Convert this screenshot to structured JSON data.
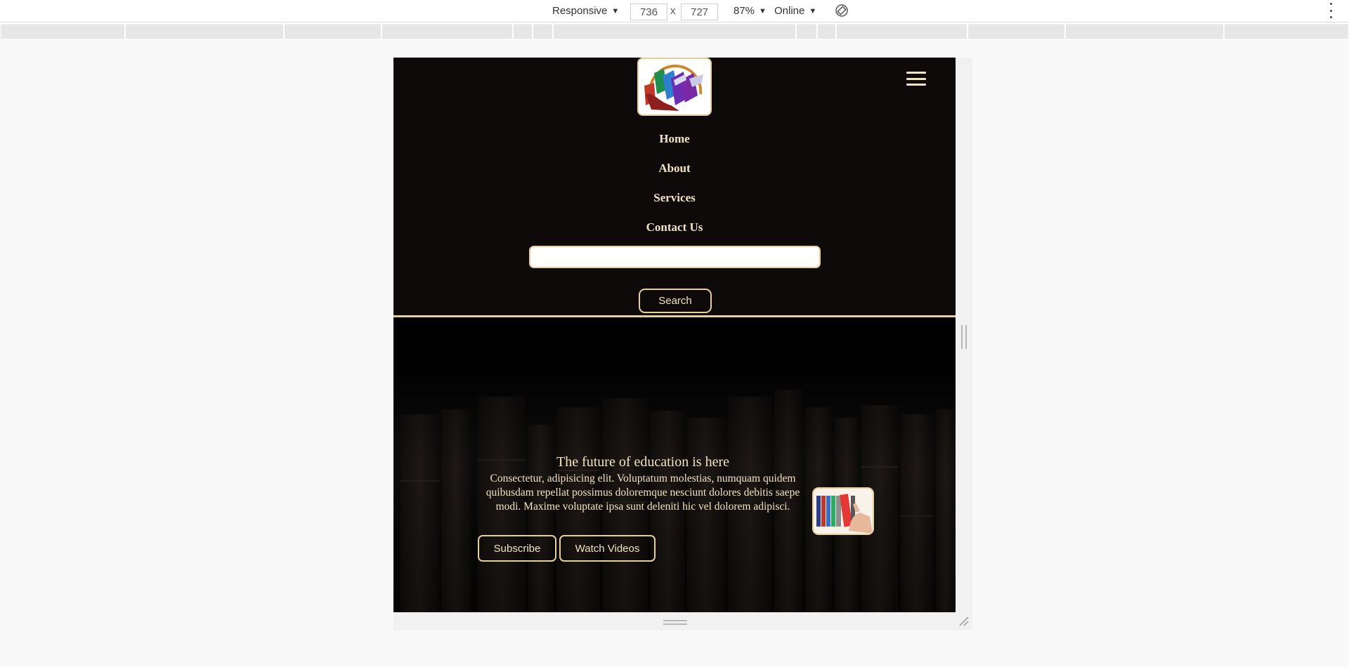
{
  "devtools": {
    "device": "Responsive",
    "width": "736",
    "times": "x",
    "height": "727",
    "zoom": "87%",
    "network": "Online",
    "icons": {
      "rotate": "rotate-icon",
      "more": "kebab-menu-icon"
    }
  },
  "site": {
    "logo": "books-logo",
    "nav": [
      {
        "label": "Home"
      },
      {
        "label": "About"
      },
      {
        "label": "Services"
      },
      {
        "label": "Contact Us"
      }
    ],
    "search": {
      "value": "",
      "button": "Search"
    },
    "menu_icon": "hamburger-icon"
  },
  "hero": {
    "title": "The future of education is here",
    "text": "Consectetur, adipisicing elit. Voluptatum molestias, numquam quidem quibusdam repellat possimus doloremque nesciunt dolores debitis saepe modi. Maxime voluptate ipsa sunt deleniti hic vel dolorem adipisci.",
    "buttons": {
      "subscribe": "Subscribe",
      "videos": "Watch Videos"
    }
  },
  "colors": {
    "accent": "#e8cf9f",
    "text": "#f4e3c2",
    "header_bg": "#0e0a0a"
  }
}
